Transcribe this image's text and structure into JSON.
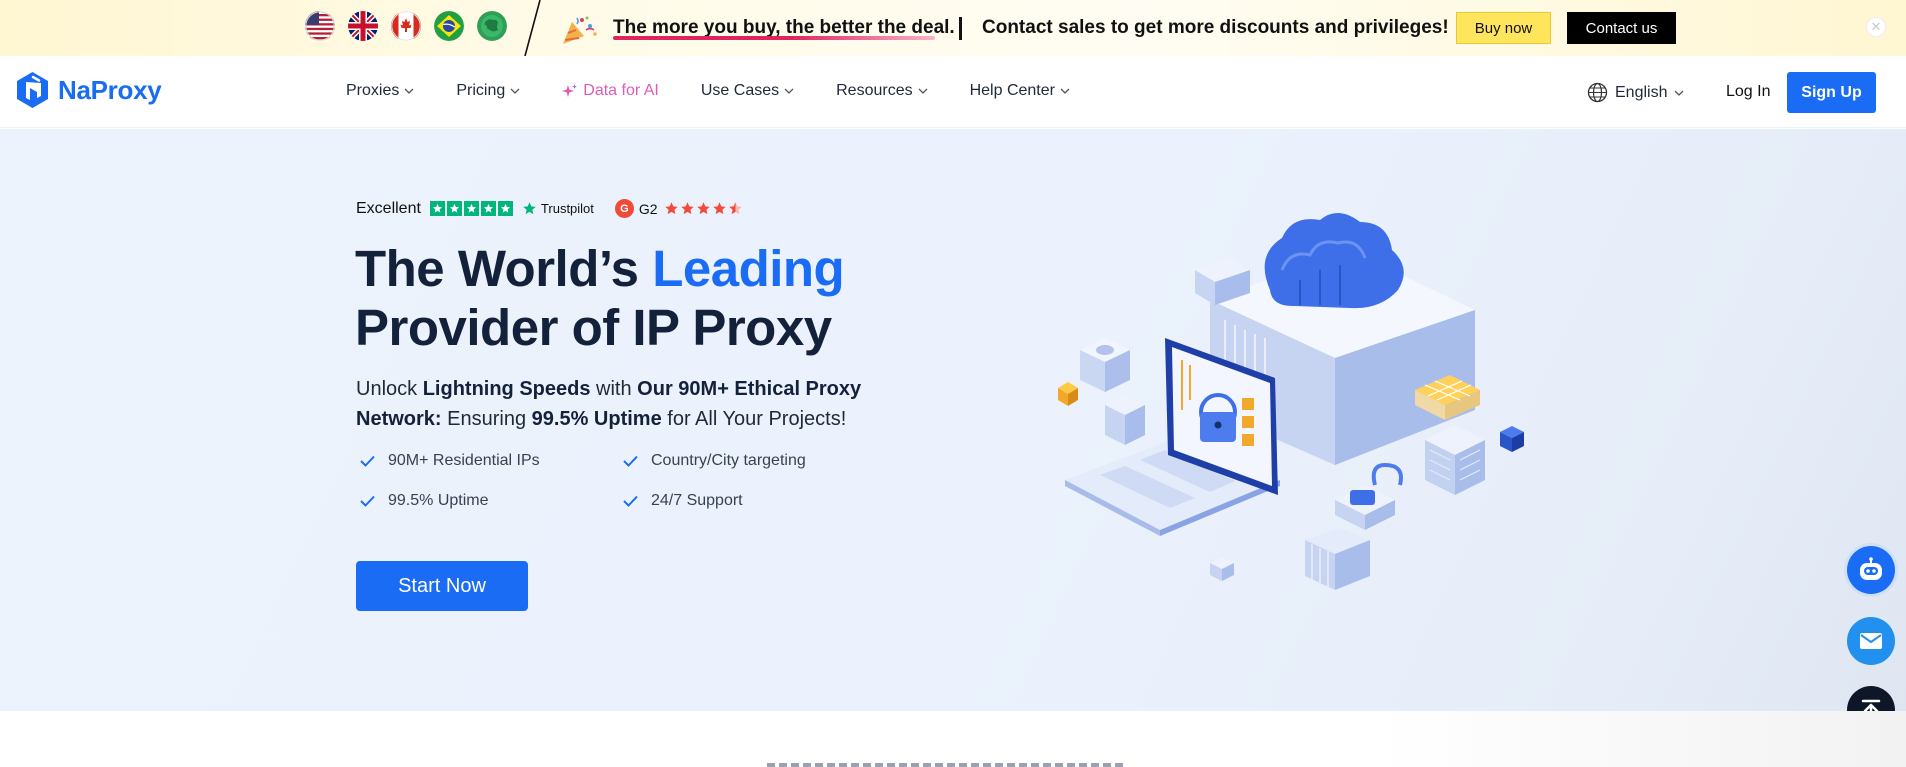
{
  "promo": {
    "flags": [
      "us-flag-icon",
      "uk-flag-icon",
      "canada-flag-icon",
      "brazil-flag-icon",
      "globe-flag-icon"
    ],
    "message1": "The more you buy, the better the deal.",
    "message2": "Contact sales to get more discounts and privileges!",
    "buy_label": "Buy now",
    "contact_label": "Contact us",
    "close_symbol": "✕"
  },
  "nav": {
    "logo_text": "NaProxy",
    "items": [
      {
        "label": "Proxies",
        "has_dropdown": true
      },
      {
        "label": "Pricing",
        "has_dropdown": true
      },
      {
        "label": "Data for AI",
        "has_dropdown": false
      },
      {
        "label": "Use Cases",
        "has_dropdown": true
      },
      {
        "label": "Resources",
        "has_dropdown": true
      },
      {
        "label": "Help Center",
        "has_dropdown": true
      }
    ],
    "language": "English",
    "login_label": "Log In",
    "signup_label": "Sign Up"
  },
  "hero": {
    "rating_label": "Excellent",
    "trustpilot_label": "Trustpilot",
    "g2_label": "G2",
    "g2_badge": "G",
    "headline_part1": "The World’s ",
    "headline_accent": "Leading",
    "headline_line2": "Provider of IP Proxy",
    "sub_1": "Unlock ",
    "sub_b1": "Lightning Speeds",
    "sub_2": " with ",
    "sub_b2": "Our 90M+ Ethical Proxy Network:",
    "sub_3": " Ensuring ",
    "sub_b3": "99.5% Uptime",
    "sub_4": " for All Your Projects!",
    "features": [
      "90M+ Residential IPs",
      "Country/City targeting",
      "99.5% Uptime",
      "24/7 Support"
    ],
    "cta_label": "Start Now"
  },
  "colors": {
    "brand": "#1a6cf5",
    "ai_pink": "#e05bb6",
    "trustpilot_green": "#00b67a",
    "g2_red": "#ef4b38",
    "promo_yellow": "#ffe55c"
  },
  "floating": [
    "robot-chat-icon",
    "mail-icon",
    "back-to-top-icon"
  ]
}
